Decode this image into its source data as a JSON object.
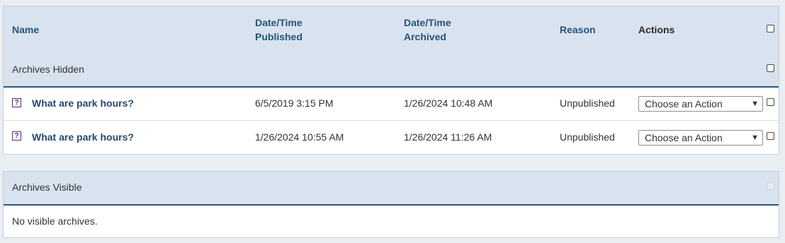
{
  "columns": {
    "name": "Name",
    "published_l1": "Date/Time",
    "published_l2": "Published",
    "archived_l1": "Date/Time",
    "archived_l2": "Archived",
    "reason": "Reason",
    "actions": "Actions"
  },
  "hidden_group": {
    "label": "Archives Hidden",
    "rows": [
      {
        "name": "What are park hours?",
        "published": "6/5/2019 3:15 PM",
        "archived": "1/26/2024 10:48 AM",
        "reason": "Unpublished",
        "action": "Choose an Action"
      },
      {
        "name": "What are park hours?",
        "published": "1/26/2024 10:55 AM",
        "archived": "1/26/2024 11:26 AM",
        "reason": "Unpublished",
        "action": "Choose an Action"
      }
    ]
  },
  "visible_group": {
    "label": "Archives Visible",
    "empty_message": "No visible archives."
  },
  "icons": {
    "question": "?",
    "chevron": "▼"
  },
  "colors": {
    "header_bg": "#d9e3ef",
    "header_text": "#26537a",
    "link": "#25496f",
    "divider": "#2a5a82",
    "question_icon": "#5a2d9a"
  }
}
